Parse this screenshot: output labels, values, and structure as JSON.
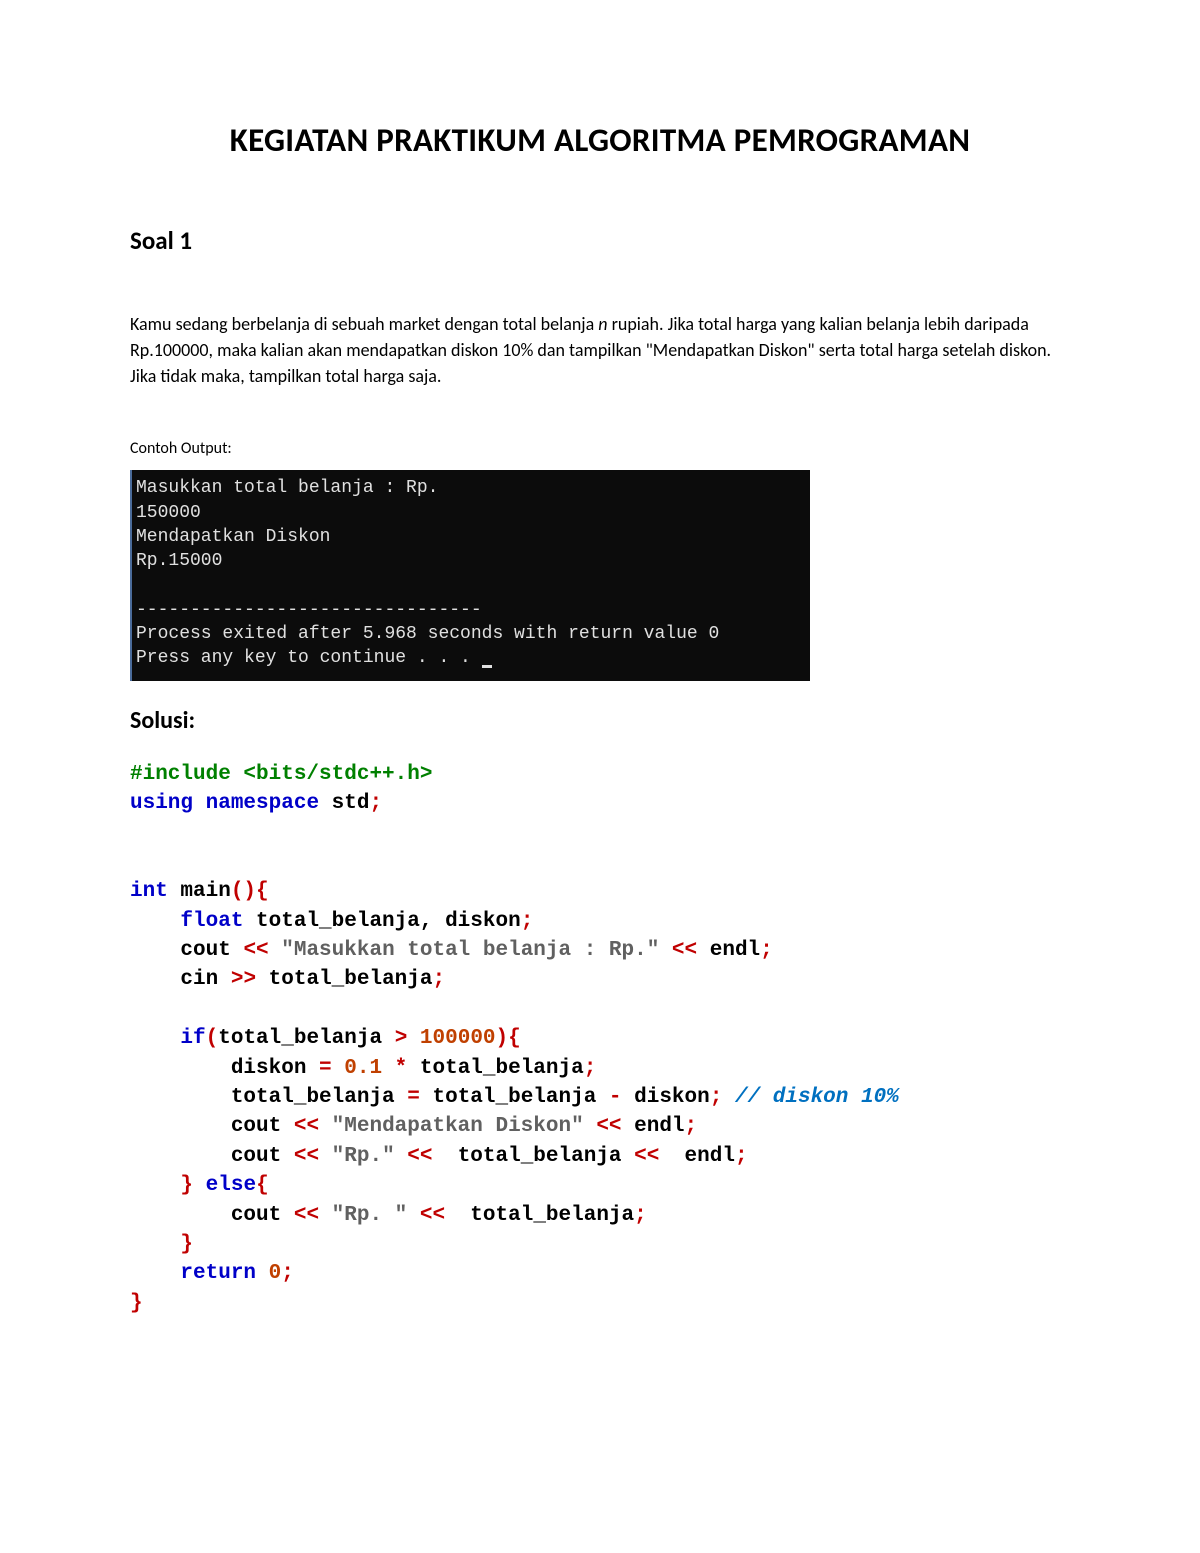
{
  "title": "KEGIATAN PRAKTIKUM ALGORITMA PEMROGRAMAN",
  "heading1": "Soal 1",
  "para_before_n": "Kamu sedang berbelanja di sebuah market dengan total belanja ",
  "para_n": "n",
  "para_after_n": " rupiah. Jika total harga yang kalian belanja lebih daripada Rp.100000, maka kalian akan mendapatkan diskon 10% dan tampilkan \"Mendapatkan Diskon\" serta total harga setelah diskon. Jika tidak maka, tampilkan total harga saja.",
  "output_label": "Contoh Output:",
  "terminal": {
    "l1": "Masukkan total belanja : Rp.",
    "l2": "150000",
    "l3": "Mendapatkan Diskon",
    "l4": "Rp.15000",
    "l5": "",
    "l6": "--------------------------------",
    "l7": "Process exited after 5.968 seconds with return value 0",
    "l8": "Press any key to continue . . . "
  },
  "solution_heading": "Solusi:",
  "code": {
    "include_hash": "#include ",
    "include_lib": "<bits/stdc++.h>",
    "using": "using",
    "namespace": "namespace",
    "std": " std",
    "semi": ";",
    "int": "int",
    "main": " main",
    "paren_open": "(",
    "paren_close": ")",
    "brace_open": "{",
    "brace_close": "}",
    "float": "float",
    "vars": " total_belanja, diskon",
    "cout": "cout ",
    "lshift": "<< ",
    "str1": "\"Masukkan total belanja : Rp.\"",
    "endl": " endl",
    "cin": "cin ",
    "rshift": ">> ",
    "tb": "total_belanja",
    "if": "if",
    "cond_open": "(",
    "cond_var": "total_belanja ",
    "gt": "> ",
    "num1": "100000",
    "cond_close": ")",
    "diskon_var": "diskon ",
    "eq": "= ",
    "num2": "0.1",
    "star": " * ",
    "tb2": "total_belanja",
    "tb_assign": "total_belanja ",
    "minus": " - ",
    "diskon2": "diskon",
    "comment": "// diskon 10%",
    "str2": "\"Mendapatkan Diskon\"",
    "str3": "\"Rp.\"",
    "tb3": " total_belanja ",
    "else": "else",
    "str4": "\"Rp. \"",
    "tb4": " total_belanja",
    "return": "return",
    "zero": " 0"
  }
}
